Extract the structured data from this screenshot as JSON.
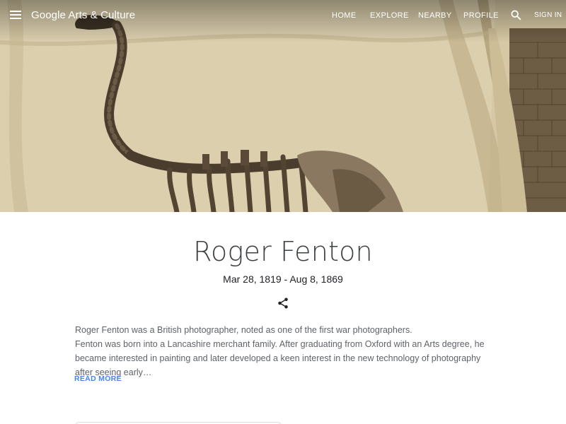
{
  "header": {
    "logo_text": "Google Arts & Culture",
    "nav": [
      "HOME",
      "EXPLORE",
      "NEARBY",
      "PROFILE"
    ],
    "sign_in_label": "SIGN IN",
    "menu_icon": "hamburger-menu-icon",
    "search_icon": "search-icon"
  },
  "artist": {
    "name": "Roger Fenton",
    "dates": "Mar 28, 1819 - Aug 8, 1869",
    "share_icon": "share-icon",
    "description_lines": [
      "Roger Fenton was a British photographer, noted as one of the first war photographers.",
      "Fenton was born into a Lancashire merchant family. After graduating from Oxford with an Arts degree, he became interested in painting and later developed a keen interest in the new technology of photography after seeing early…"
    ],
    "read_more_label": "READ MORE"
  },
  "colors": {
    "link": "#4285f4",
    "title": "#3c4043",
    "body_text": "#5f6368"
  }
}
